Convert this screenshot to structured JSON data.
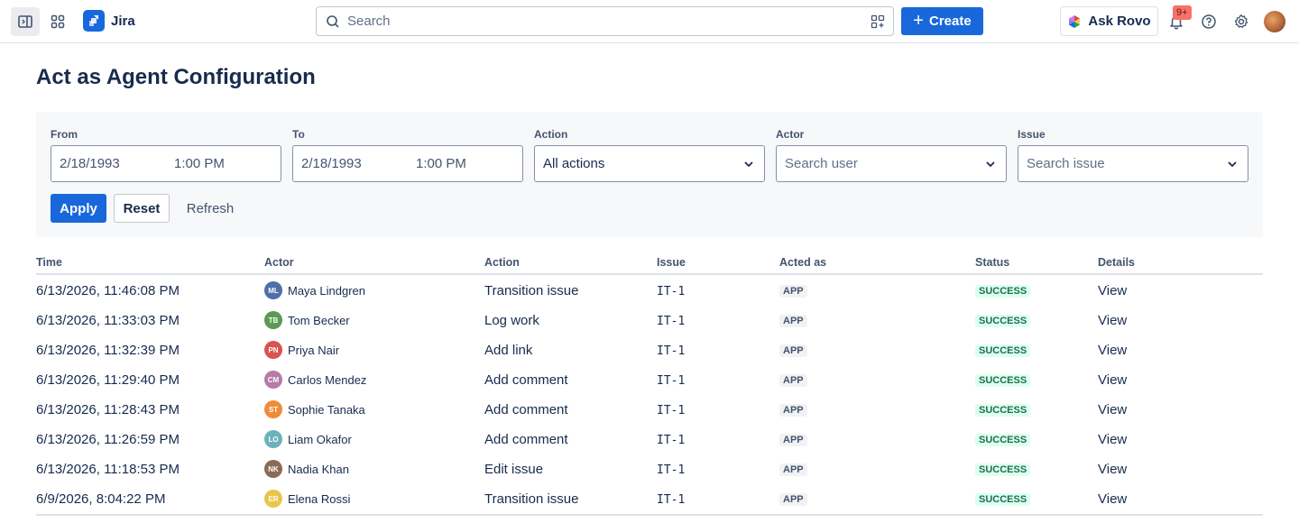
{
  "nav": {
    "app_name": "Jira",
    "search_placeholder": "Search",
    "create_label": "Create",
    "rovo_label": "Ask Rovo",
    "notifications_badge": "9+"
  },
  "page": {
    "title": "Act as Agent Configuration"
  },
  "filters": {
    "from": {
      "label": "From",
      "date": "2/18/1993",
      "time": "1:00 PM"
    },
    "to": {
      "label": "To",
      "date": "2/18/1993",
      "time": "1:00 PM"
    },
    "action": {
      "label": "Action",
      "value": "All actions"
    },
    "actor": {
      "label": "Actor",
      "placeholder": "Search user"
    },
    "issue": {
      "label": "Issue",
      "placeholder": "Search issue"
    },
    "apply_label": "Apply",
    "reset_label": "Reset",
    "refresh_label": "Refresh"
  },
  "table": {
    "columns": [
      "Time",
      "Actor",
      "Action",
      "Issue",
      "Acted as",
      "Status",
      "Details"
    ],
    "rows": [
      {
        "time": "6/13/2026, 11:46:08 PM",
        "initials": "ML",
        "avatar_color": "#4f6fa8",
        "actor": "Maya Lindgren",
        "action": "Transition issue",
        "issue": "IT-1",
        "acted_as": "APP",
        "status": "SUCCESS",
        "details": "View"
      },
      {
        "time": "6/13/2026, 11:33:03 PM",
        "initials": "TB",
        "avatar_color": "#5b9a53",
        "actor": "Tom Becker",
        "action": "Log work",
        "issue": "IT-1",
        "acted_as": "APP",
        "status": "SUCCESS",
        "details": "View"
      },
      {
        "time": "6/13/2026, 11:32:39 PM",
        "initials": "PN",
        "avatar_color": "#d9534f",
        "actor": "Priya Nair",
        "action": "Add link",
        "issue": "IT-1",
        "acted_as": "APP",
        "status": "SUCCESS",
        "details": "View"
      },
      {
        "time": "6/13/2026, 11:29:40 PM",
        "initials": "CM",
        "avatar_color": "#b67aa7",
        "actor": "Carlos Mendez",
        "action": "Add comment",
        "issue": "IT-1",
        "acted_as": "APP",
        "status": "SUCCESS",
        "details": "View"
      },
      {
        "time": "6/13/2026, 11:28:43 PM",
        "initials": "ST",
        "avatar_color": "#ee8c3a",
        "actor": "Sophie Tanaka",
        "action": "Add comment",
        "issue": "IT-1",
        "acted_as": "APP",
        "status": "SUCCESS",
        "details": "View"
      },
      {
        "time": "6/13/2026, 11:26:59 PM",
        "initials": "LO",
        "avatar_color": "#6cb2bb",
        "actor": "Liam Okafor",
        "action": "Add comment",
        "issue": "IT-1",
        "acted_as": "APP",
        "status": "SUCCESS",
        "details": "View"
      },
      {
        "time": "6/13/2026, 11:18:53 PM",
        "initials": "NK",
        "avatar_color": "#8c6a55",
        "actor": "Nadia Khan",
        "action": "Edit issue",
        "issue": "IT-1",
        "acted_as": "APP",
        "status": "SUCCESS",
        "details": "View"
      },
      {
        "time": "6/9/2026, 8:04:22 PM",
        "initials": "ER",
        "avatar_color": "#e9c54c",
        "actor": "Elena Rossi",
        "action": "Transition issue",
        "issue": "IT-1",
        "acted_as": "APP",
        "status": "SUCCESS",
        "details": "View"
      }
    ]
  }
}
